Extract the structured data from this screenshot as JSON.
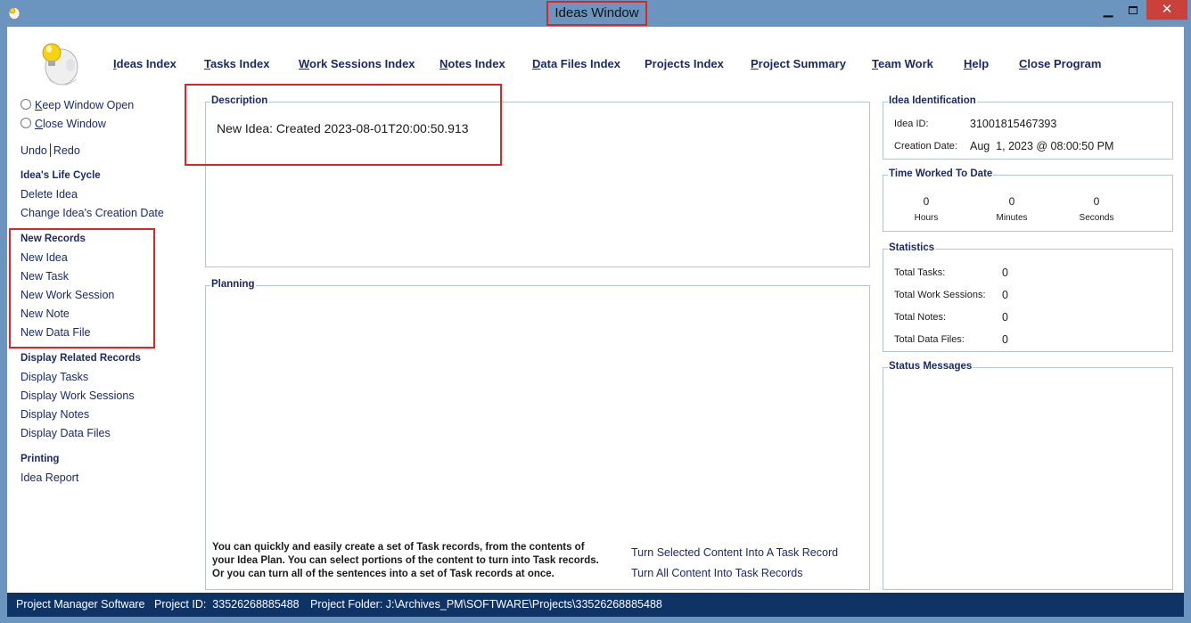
{
  "window": {
    "title": "Ideas Window",
    "minimize_icon": "minimize-icon",
    "maximize_icon": "maximize-icon",
    "close_glyph": "✕"
  },
  "nav": {
    "items": [
      {
        "u": "I",
        "rest": "deas Index"
      },
      {
        "u": "T",
        "rest": "asks Index"
      },
      {
        "u": "W",
        "rest": "ork Sessions Index"
      },
      {
        "u": "N",
        "rest": "otes Index"
      },
      {
        "u": "D",
        "rest": "ata Files Index"
      },
      {
        "u": "",
        "rest": "Projects Index"
      },
      {
        "u": "P",
        "rest": "roject Summary"
      },
      {
        "u": "T",
        "rest": "eam Work"
      },
      {
        "u": "H",
        "rest": "elp"
      },
      {
        "u": "C",
        "rest": "lose Program"
      }
    ]
  },
  "sidebar": {
    "keep_open": {
      "u": "K",
      "rest": "eep Window Open"
    },
    "close_window": {
      "u": "C",
      "rest": "lose Window"
    },
    "undo": "Undo",
    "redo": "Redo",
    "life_cycle": {
      "heading": "Idea's Life Cycle",
      "items": [
        "Delete Idea",
        "Change Idea's Creation Date"
      ]
    },
    "new_records": {
      "heading": "New Records",
      "items": [
        "New Idea",
        "New Task",
        "New Work Session",
        "New Note",
        "New Data File"
      ]
    },
    "related": {
      "heading": "Display Related Records",
      "items": [
        "Display Tasks",
        "Display Work Sessions",
        "Display Notes",
        "Display Data Files"
      ]
    },
    "printing": {
      "heading": "Printing",
      "items": [
        "Idea Report"
      ]
    }
  },
  "description": {
    "label": "Description",
    "text": "New Idea: Created 2023-08-01T20:00:50.913"
  },
  "planning": {
    "label": "Planning",
    "help_lines": [
      "You can quickly and easily create a set of Task records, from the contents of",
      "your Idea Plan. You can select portions of the content to turn into Task records.",
      "Or you can turn all of the sentences into a set of Task records at once."
    ],
    "link_selected": "Turn Selected Content Into A Task Record",
    "link_all": "Turn All Content Into Task Records"
  },
  "identification": {
    "label": "Idea Identification",
    "id_label": "Idea ID:",
    "id_value": "31001815467393",
    "date_label": "Creation Date:",
    "date_value": "Aug  1, 2023 @ 08:00:50 PM"
  },
  "time_worked": {
    "label": "Time Worked To Date",
    "hours": "0",
    "hours_label": "Hours",
    "minutes": "0",
    "minutes_label": "Minutes",
    "seconds": "0",
    "seconds_label": "Seconds"
  },
  "statistics": {
    "label": "Statistics",
    "rows": [
      {
        "label": "Total Tasks:",
        "value": "0"
      },
      {
        "label": "Total Work Sessions:",
        "value": "0"
      },
      {
        "label": "Total Notes:",
        "value": "0"
      },
      {
        "label": "Total Data Files:",
        "value": "0"
      }
    ]
  },
  "status_messages": {
    "label": "Status Messages"
  },
  "statusbar": {
    "app": "Project Manager Software",
    "project_id": "Project ID:  33526268885488",
    "project_folder": "Project Folder: J:\\Archives_PM\\SOFTWARE\\Projects\\33526268885488"
  },
  "colors": {
    "chrome": "#6b95bf",
    "link_text": "#1b2a64",
    "highlight": "#e02424",
    "statusbar": "#0f3364",
    "close_button": "#c9413a"
  }
}
